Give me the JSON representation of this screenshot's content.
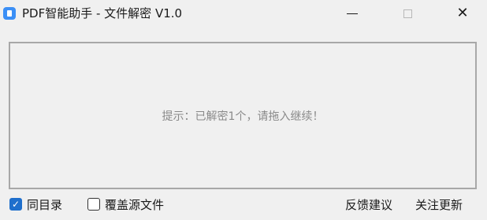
{
  "window": {
    "title": "PDF智能助手 - 文件解密 V1.0",
    "icon": "app-icon",
    "controls": {
      "minimize_icon": "minimize-icon",
      "maximize_icon": "maximize-icon",
      "close_icon": "close-icon",
      "close_glyph": "✕"
    }
  },
  "drop_area": {
    "hint": "提示：已解密1个，请拖入继续！"
  },
  "footer": {
    "same_dir": {
      "label": "同目录",
      "checked": true,
      "check_glyph": "✓"
    },
    "overwrite_source": {
      "label": "覆盖源文件",
      "checked": false
    },
    "feedback_label": "反馈建议",
    "follow_update_label": "关注更新"
  },
  "colors": {
    "accent": "#1f6fcc",
    "hint_text": "#8a8a8a",
    "border": "#a8a8a8",
    "background": "#f0f0f0"
  }
}
